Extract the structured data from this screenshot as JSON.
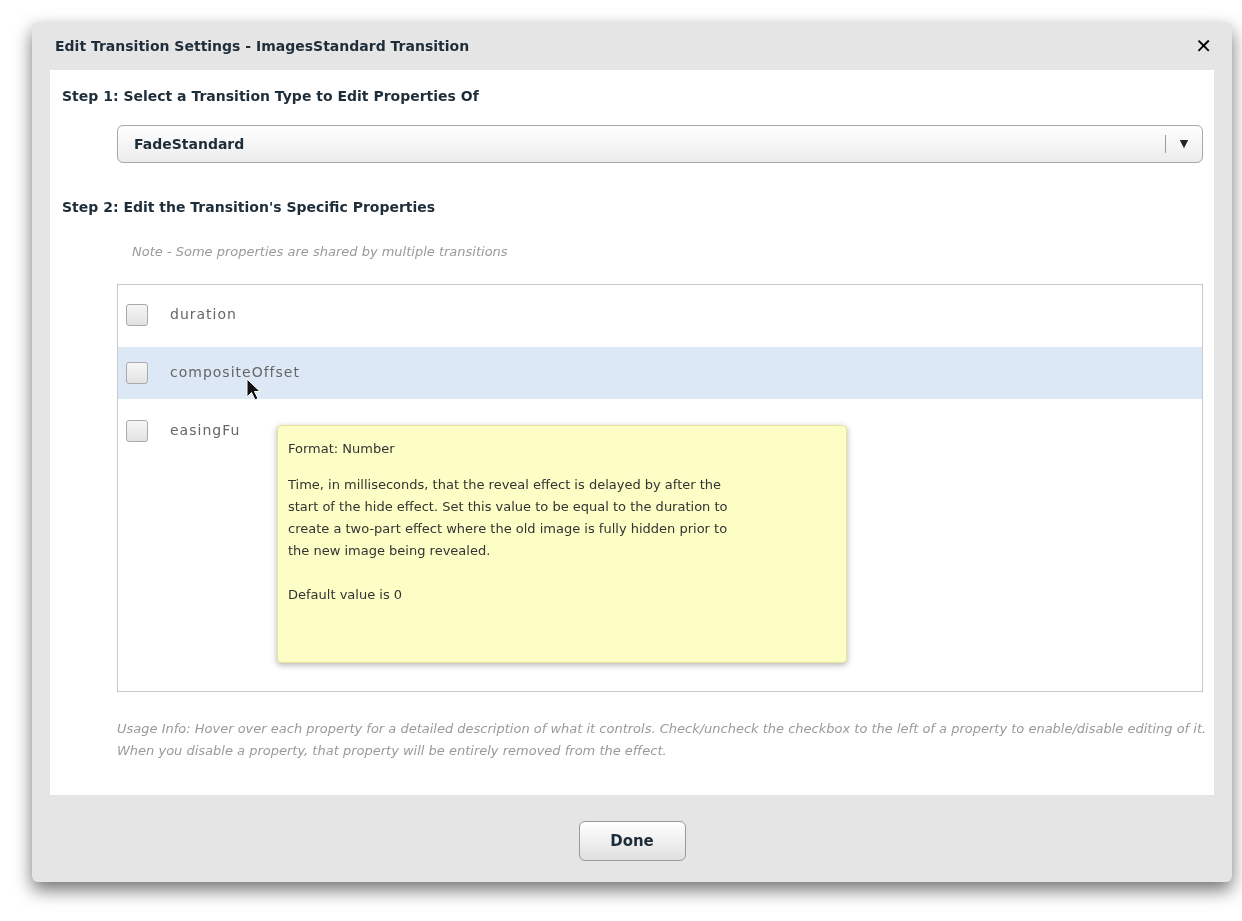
{
  "dialog": {
    "title": "Edit Transition Settings - ImagesStandard Transition",
    "close": "✕"
  },
  "step1": {
    "label": "Step 1: Select a Transition Type to Edit Properties Of",
    "select": {
      "value": "FadeStandard",
      "arrow": "▼"
    }
  },
  "step2": {
    "label": "Step 2: Edit the Transition's Specific Properties",
    "note": "Note - Some properties are shared by multiple transitions"
  },
  "properties": [
    {
      "name": "duration",
      "checked": false,
      "selected": false
    },
    {
      "name": "compositeOffset",
      "checked": false,
      "selected": true
    },
    {
      "name": "easingFu",
      "checked": false,
      "selected": false
    }
  ],
  "tooltip": {
    "format": "Format: Number",
    "description": "Time, in milliseconds, that the reveal effect is delayed by after the start of the hide effect.  Set this value to be equal to the duration to create a two-part effect where the old image is fully hidden prior to the new image being revealed.",
    "default": "Default value is 0"
  },
  "usage_info": "Usage Info: Hover over each property for a detailed description of what it controls.  Check/uncheck the checkbox to the left of a property to enable/disable editing of it.  When you disable a property, that property will be entirely removed from the effect.",
  "buttons": [
    "Done"
  ]
}
